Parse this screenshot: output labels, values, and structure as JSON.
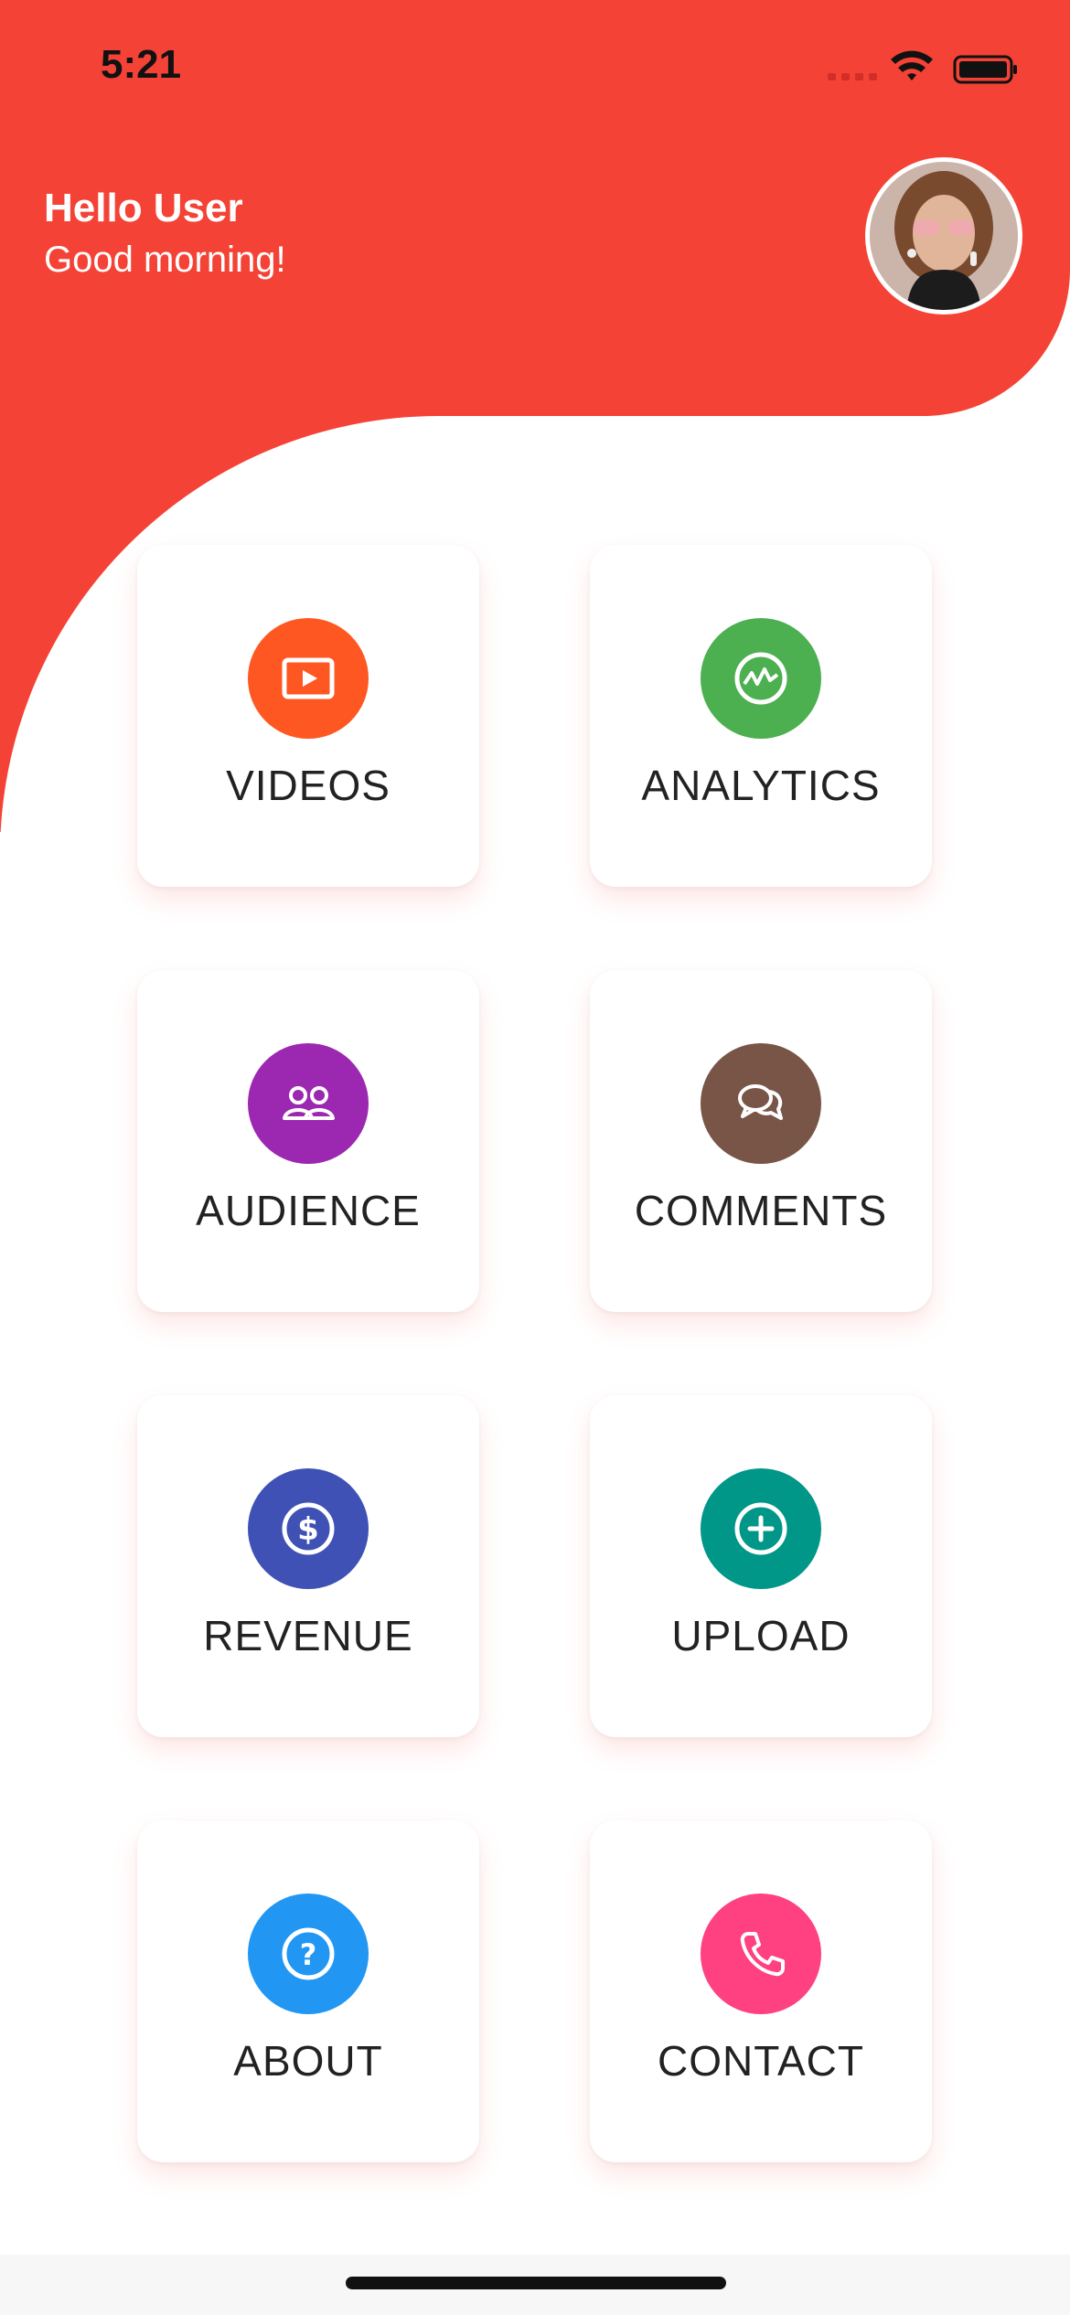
{
  "status_bar": {
    "time": "5:21"
  },
  "header": {
    "title": "Hello User",
    "subtitle": "Good morning!",
    "avatar_icon": "user-avatar-photo"
  },
  "colors": {
    "header_bg": "#f44336",
    "videos": "#ff5722",
    "analytics": "#4caf50",
    "audience": "#9c27b0",
    "comments": "#795548",
    "revenue": "#3f51b5",
    "upload": "#009688",
    "about": "#2196f3",
    "contact": "#ff4081"
  },
  "menu": {
    "items": [
      {
        "label": "VIDEOS",
        "icon": "play-video-icon",
        "color": "#ff5722"
      },
      {
        "label": "ANALYTICS",
        "icon": "analytics-chart-icon",
        "color": "#4caf50"
      },
      {
        "label": "AUDIENCE",
        "icon": "people-icon",
        "color": "#9c27b0"
      },
      {
        "label": "COMMENTS",
        "icon": "chat-bubbles-icon",
        "color": "#795548"
      },
      {
        "label": "REVENUE",
        "icon": "dollar-icon",
        "color": "#3f51b5"
      },
      {
        "label": "UPLOAD",
        "icon": "add-circle-icon",
        "color": "#009688"
      },
      {
        "label": "ABOUT",
        "icon": "help-circle-icon",
        "color": "#2196f3"
      },
      {
        "label": "CONTACT",
        "icon": "phone-icon",
        "color": "#ff4081"
      }
    ]
  }
}
